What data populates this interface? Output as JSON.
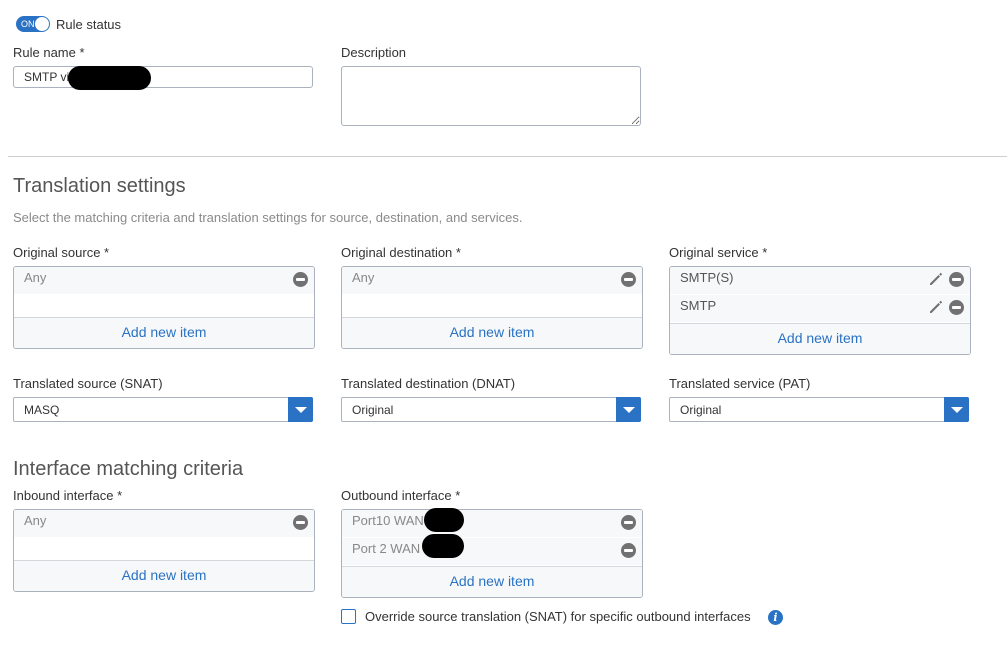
{
  "rule_status": {
    "toggle_label": "ON",
    "label": "Rule status"
  },
  "rule_name": {
    "label": "Rule name *",
    "value": "SMTP vi"
  },
  "description": {
    "label": "Description",
    "value": ""
  },
  "translation": {
    "heading": "Translation settings",
    "subtitle": "Select the matching criteria and translation settings for source, destination, and services.",
    "original_source": {
      "label": "Original source *",
      "items": [
        "Any"
      ],
      "add_label": "Add new item"
    },
    "original_destination": {
      "label": "Original destination *",
      "items": [
        "Any"
      ],
      "add_label": "Add new item"
    },
    "original_service": {
      "label": "Original service *",
      "items": [
        "SMTP(S)",
        "SMTP"
      ],
      "add_label": "Add new item"
    },
    "translated_source": {
      "label": "Translated source (SNAT)",
      "value": "MASQ"
    },
    "translated_destination": {
      "label": "Translated destination (DNAT)",
      "value": "Original"
    },
    "translated_service": {
      "label": "Translated service (PAT)",
      "value": "Original"
    }
  },
  "interface": {
    "heading": "Interface matching criteria",
    "inbound": {
      "label": "Inbound interface *",
      "items": [
        "Any"
      ],
      "add_label": "Add new item"
    },
    "outbound": {
      "label": "Outbound interface *",
      "items": [
        "Port10 WAN",
        "Port 2 WAN"
      ],
      "add_label": "Add new item"
    },
    "override_label": "Override source translation (SNAT) for specific outbound interfaces"
  },
  "colors": {
    "accent": "#2a72c4",
    "border": "#aab2bd",
    "muted": "#8a8a8a"
  }
}
